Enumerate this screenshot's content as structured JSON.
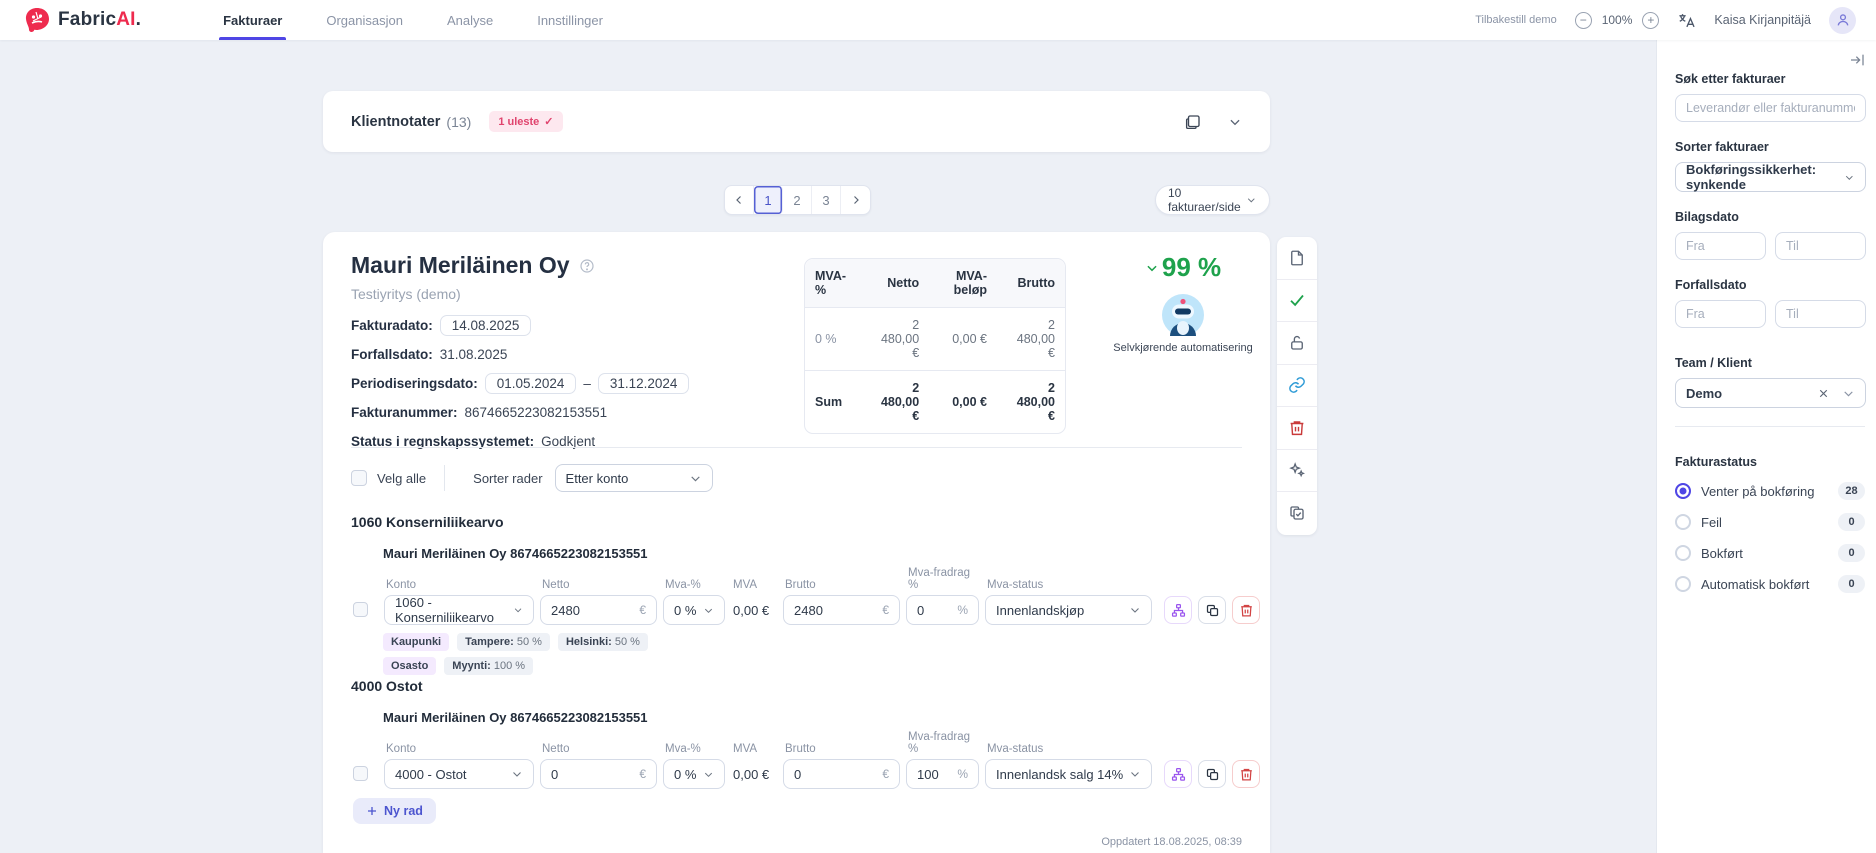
{
  "colors": {
    "accent": "#4f46e5",
    "brand": "#ee2b4e",
    "success_green": "#1ea24c",
    "link_blue": "#2f9bd6",
    "danger_red": "#d24444",
    "purple": "#9a55ee"
  },
  "header": {
    "logo": {
      "part1": "Fabric",
      "part2": "AI",
      "part3": "."
    },
    "nav": [
      {
        "label": "Fakturaer",
        "active": true
      },
      {
        "label": "Organisasjon",
        "active": false
      },
      {
        "label": "Analyse",
        "active": false
      },
      {
        "label": "Innstillinger",
        "active": false
      }
    ],
    "reset_demo_label": "Tilbakestill demo",
    "zoom_level": "100%",
    "zoom_out_glyph": "−",
    "zoom_in_glyph": "+",
    "user_name": "Kaisa Kirjanpitäjä"
  },
  "notes_panel": {
    "title": "Klientnotater",
    "count": "(13)",
    "unread_label": "1 uleste",
    "unread_check": "✓"
  },
  "pagination": {
    "pages": [
      "1",
      "2",
      "3"
    ],
    "active_page": "1",
    "page_size_label": "10 fakturaer/side"
  },
  "invoice": {
    "title": "Mauri Meriläinen Oy",
    "subtitle": "Testiyritys (demo)",
    "meta": {
      "fakturadato_label": "Fakturadato:",
      "fakturadato_value": "14.08.2025",
      "forfallsdato_label": "Forfallsdato:",
      "forfallsdato_value": "31.08.2025",
      "period_label": "Periodiseringsdato:",
      "period_from": "01.05.2024",
      "period_sep": "–",
      "period_to": "31.12.2024",
      "fakturanummer_label": "Fakturanummer:",
      "fakturanummer_value": "8674665223082153551",
      "status_label": "Status i regnskapssystemet:",
      "status_value": "Godkjent"
    },
    "vat_table": {
      "headers": [
        "MVA-%",
        "Netto",
        "MVA-beløp",
        "Brutto"
      ],
      "rows": [
        [
          "0 %",
          "2 480,00 €",
          "0,00 €",
          "2 480,00 €"
        ]
      ],
      "sum_row": [
        "Sum",
        "2 480,00 €",
        "0,00 €",
        "2 480,00 €"
      ]
    },
    "confidence": {
      "value": "99 %",
      "label": "Selvkjørende automatisering"
    },
    "controls": {
      "select_all_label": "Velg alle",
      "sort_label": "Sorter rader",
      "sort_value": "Etter konto"
    },
    "column_labels": {
      "konto": "Konto",
      "netto": "Netto",
      "mva_pct": "Mva-%",
      "mva": "MVA",
      "brutto": "Brutto",
      "fradrag": "Mva-fradrag %",
      "status": "Mva-status"
    },
    "euro_unit": "€",
    "pct_unit": "%",
    "sections": [
      {
        "heading": "1060 Konserniliikearvo",
        "row_title": "Mauri Meriläinen Oy 8674665223082153551",
        "konto": "1060 - Konserniliikearvo",
        "netto": "2480",
        "mva_pct": "0 %",
        "mva": "0,00 €",
        "brutto": "2480",
        "fradrag": "0",
        "status": "Innenlandskjøp",
        "tags1": [
          {
            "name": "Kaupunki",
            "value": ""
          },
          {
            "name": "Tampere:",
            "value": "50 %"
          },
          {
            "name": "Helsinki:",
            "value": "50 %"
          }
        ],
        "tags2": [
          {
            "name": "Osasto",
            "value": ""
          },
          {
            "name": "Myynti:",
            "value": "100 %"
          }
        ]
      },
      {
        "heading": "4000 Ostot",
        "row_title": "Mauri Meriläinen Oy 8674665223082153551",
        "konto": "4000 - Ostot",
        "netto": "0",
        "mva_pct": "0 %",
        "mva": "0,00 €",
        "brutto": "0",
        "fradrag": "100",
        "status": "Innenlandsk salg 14%"
      }
    ],
    "new_row_label": "Ny rad",
    "updated_label": "Oppdatert 18.08.2025, 08:39"
  },
  "sidebar": {
    "search_label": "Søk etter fakturaer",
    "search_placeholder": "Leverandør eller fakturanummer",
    "sort_label": "Sorter fakturaer",
    "sort_value": "Bokføringssikkerhet: synkende",
    "bilagsdato_label": "Bilagsdato",
    "forfallsdato_label": "Forfallsdato",
    "from_placeholder": "Fra",
    "to_placeholder": "Til",
    "team_label": "Team / Klient",
    "team_value": "Demo",
    "status_label": "Fakturastatus",
    "status_options": [
      {
        "label": "Venter på bokføring",
        "count": "28",
        "selected": true
      },
      {
        "label": "Feil",
        "count": "0",
        "selected": false
      },
      {
        "label": "Bokført",
        "count": "0",
        "selected": false
      },
      {
        "label": "Automatisk bokført",
        "count": "0",
        "selected": false
      }
    ]
  }
}
